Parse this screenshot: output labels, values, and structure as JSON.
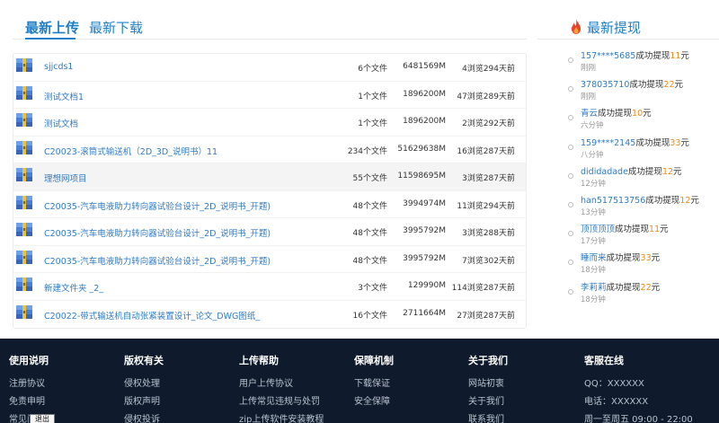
{
  "tabs": [
    {
      "label": "最新上传",
      "active": true
    },
    {
      "label": "最新下载",
      "active": false
    }
  ],
  "files": [
    {
      "name": "sjjcds1",
      "count": "6个文件",
      "size": "6481569M",
      "views": "4浏览294天前"
    },
    {
      "name": "测试文档1",
      "count": "1个文件",
      "size": "1896200M",
      "views": "47浏览289天前"
    },
    {
      "name": "测试文档",
      "count": "1个文件",
      "size": "1896200M",
      "views": "2浏览292天前"
    },
    {
      "name": "C20023-滚筒式输送机（2D_3D_说明书）11",
      "count": "234个文件",
      "size": "51629638M",
      "views": "16浏览287天前"
    },
    {
      "name": "理想网项目",
      "count": "55个文件",
      "size": "11598695M",
      "views": "3浏览287天前"
    },
    {
      "name": "C20035-汽车电液助力转向器试验台设计_2D_说明书_开题)",
      "count": "48个文件",
      "size": "3994974M",
      "views": "11浏览294天前"
    },
    {
      "name": "C20035-汽车电液助力转向器试验台设计_2D_说明书_开题)",
      "count": "48个文件",
      "size": "3995792M",
      "views": "3浏览288天前"
    },
    {
      "name": "C20035-汽车电液助力转向器试验台设计_2D_说明书_开题)",
      "count": "48个文件",
      "size": "3995792M",
      "views": "7浏览302天前"
    },
    {
      "name": "新建文件夹 _2_",
      "count": "3个文件",
      "size": "129990M",
      "views": "114浏览287天前"
    },
    {
      "name": "C20022-带式输送机自动张紧装置设计_论文_DWG图纸_",
      "count": "16个文件",
      "size": "2711664M",
      "views": "27浏览287天前"
    }
  ],
  "withdraw": {
    "title": "最新提现",
    "items": [
      {
        "user": "157****5685",
        "text": "成功提现",
        "amount": "11",
        "unit": "元",
        "time": "刚刚"
      },
      {
        "user": "378035710",
        "text": "成功提现",
        "amount": "22",
        "unit": "元",
        "time": "刚刚"
      },
      {
        "user": "青云",
        "text": "成功提现",
        "amount": "10",
        "unit": "元",
        "time": "六分钟"
      },
      {
        "user": "159****2145",
        "text": "成功提现",
        "amount": "33",
        "unit": "元",
        "time": "八分钟"
      },
      {
        "user": "dididadade",
        "text": "成功提现",
        "amount": "12",
        "unit": "元",
        "time": "12分钟"
      },
      {
        "user": "han517513756",
        "text": "成功提现",
        "amount": "12",
        "unit": "元",
        "time": "13分钟"
      },
      {
        "user": "顶顶顶顶",
        "text": "成功提现",
        "amount": "11",
        "unit": "元",
        "time": "17分钟"
      },
      {
        "user": "睡而来",
        "text": "成功提现",
        "amount": "33",
        "unit": "元",
        "time": "18分钟"
      },
      {
        "user": "李莉莉",
        "text": "成功提现",
        "amount": "22",
        "unit": "元",
        "time": "18分钟"
      }
    ]
  },
  "footer": [
    {
      "title": "使用说明",
      "links": [
        "注册协议",
        "免责申明",
        "常见问题"
      ]
    },
    {
      "title": "版权有关",
      "links": [
        "侵权处理",
        "版权声明",
        "侵权投诉"
      ]
    },
    {
      "title": "上传帮助",
      "links": [
        "用户上传协议",
        "上传常见违规与处罚",
        "zip上传软件安装教程"
      ]
    },
    {
      "title": "保障机制",
      "links": [
        "下载保证",
        "安全保障"
      ]
    },
    {
      "title": "关于我们",
      "links": [
        "网站初衷",
        "关于我们",
        "联系我们"
      ]
    },
    {
      "title": "客服在线",
      "links": [
        "QQ：XXXXXX",
        "电话：XXXXXX",
        "周一至周五 09:00 - 22:00"
      ]
    }
  ],
  "tooltip": "退出",
  "colors": {
    "accent": "#1e7fc8",
    "amount": "#f08a1c",
    "footer_bg": "#0f1b2c"
  }
}
